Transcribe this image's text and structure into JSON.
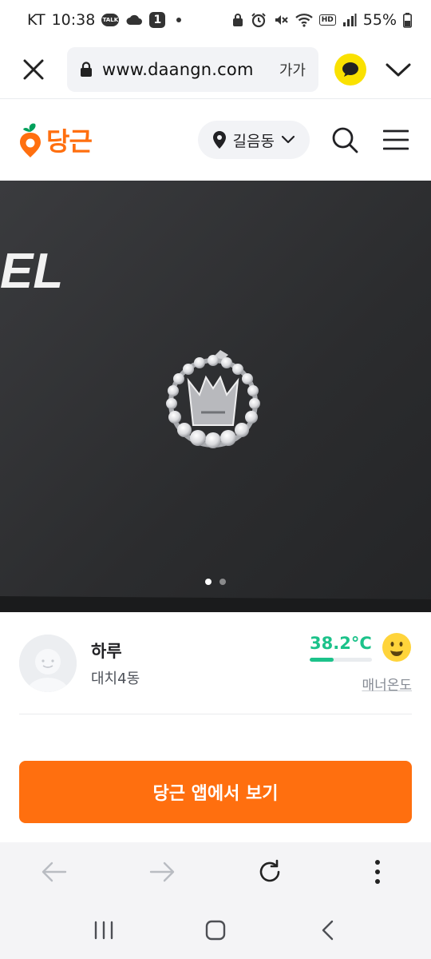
{
  "status_bar": {
    "carrier": "KT",
    "time": "10:38",
    "talk_badge": "TALK",
    "notification_count": "1",
    "hd": "HD",
    "battery": "55%"
  },
  "browser": {
    "url": "www.daangn.com",
    "text_size_label": "가가",
    "kakao_color": "#fae100"
  },
  "header": {
    "logo_text": "당근",
    "location": "길음동",
    "brand_color": "#ff6f0f"
  },
  "carousel": {
    "total": 2,
    "active_index": 0,
    "box_lettering": "EL"
  },
  "seller": {
    "name": "하루",
    "region": "대치4동",
    "temperature": "38.2°C",
    "temperature_fraction": 0.38,
    "temperature_label": "매너온도",
    "temperature_color": "#1cc28a"
  },
  "cta": {
    "label": "당근 앱에서 보기"
  },
  "bottom_bar": {
    "icons": [
      "back-arrow-icon",
      "forward-arrow-icon",
      "refresh-icon",
      "more-vertical-icon"
    ]
  },
  "nav_bar": {
    "icons": [
      "recent-apps-icon",
      "home-icon",
      "back-icon"
    ]
  }
}
